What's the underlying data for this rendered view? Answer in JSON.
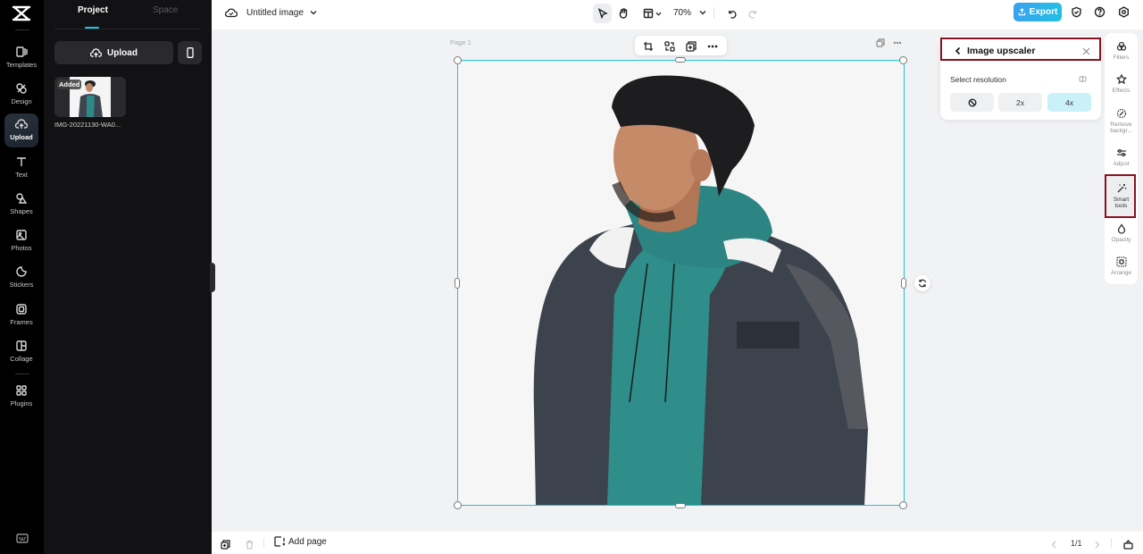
{
  "app": {
    "title": "Untitled image",
    "zoom": "70%"
  },
  "left_rail": {
    "items": [
      {
        "label": "Templates",
        "icon": "templates-icon"
      },
      {
        "label": "Design",
        "icon": "design-icon"
      },
      {
        "label": "Upload",
        "icon": "upload-icon",
        "active": true
      },
      {
        "label": "Text",
        "icon": "text-icon"
      },
      {
        "label": "Shapes",
        "icon": "shapes-icon"
      },
      {
        "label": "Photos",
        "icon": "photos-icon"
      },
      {
        "label": "Stickers",
        "icon": "stickers-icon"
      },
      {
        "label": "Frames",
        "icon": "frames-icon"
      },
      {
        "label": "Collage",
        "icon": "collage-icon"
      },
      {
        "label": "Plugins",
        "icon": "plugins-icon"
      }
    ]
  },
  "panel": {
    "tabs": [
      "Project",
      "Space"
    ],
    "active_tab": "Project",
    "upload_label": "Upload",
    "assets": [
      {
        "badge": "Added",
        "name": "IMG-20221130-WA0..."
      }
    ]
  },
  "topbar": {
    "export_label": "Export",
    "accent": "#22c5e0"
  },
  "canvas": {
    "page_label": "Page 1"
  },
  "upscaler": {
    "title": "Image upscaler",
    "select_label": "Select resolution",
    "options": [
      "none",
      "2x",
      "4x"
    ],
    "selected": "4x"
  },
  "right_rail": {
    "items": [
      {
        "label": "Filters"
      },
      {
        "label": "Effects"
      },
      {
        "label": "Remove backgr..."
      },
      {
        "label": "Adjust"
      },
      {
        "label": "Smart tools",
        "active": true
      },
      {
        "label": "Opacity"
      },
      {
        "label": "Arrange"
      }
    ]
  },
  "bottombar": {
    "add_page_label": "Add page",
    "page_count": "1/1"
  }
}
